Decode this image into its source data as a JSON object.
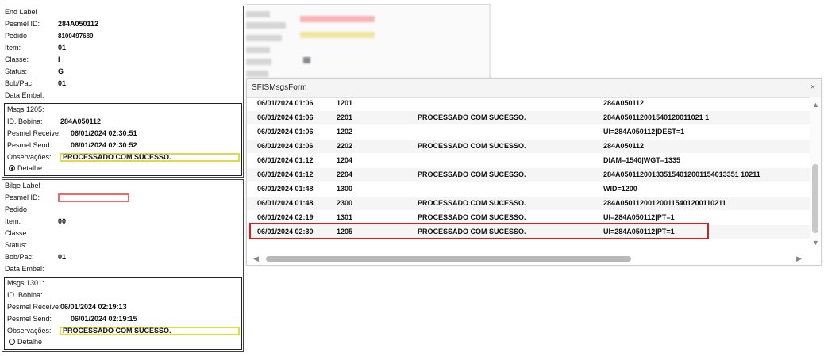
{
  "end_label": {
    "title": "End Label",
    "fields": [
      {
        "label": "Pesmel ID:",
        "value": "284A050112"
      },
      {
        "label": "Pedido",
        "value": "8100497689"
      },
      {
        "label": "Item:",
        "value": "01"
      },
      {
        "label": "Classe:",
        "value": "I"
      },
      {
        "label": "Status:",
        "value": "G"
      },
      {
        "label": "Bob/Pac:",
        "value": "01"
      },
      {
        "label": "Data Embal:",
        "value": ""
      }
    ],
    "msgs": {
      "title": "Msgs 1205:",
      "bobina_label": "ID. Bobina:",
      "bobina_value": "284A050112",
      "receive_label": "Pesmel Receive:",
      "receive_value": "06/01/2024 02:30:51",
      "send_label": "Pesmel Send:",
      "send_value": "06/01/2024 02:30:52",
      "obs_label": "Observações:",
      "obs_value": "PROCESSADO COM SUCESSO.",
      "detalhe_label": "Detalhe",
      "detalhe_checked": true
    }
  },
  "bilge_label": {
    "title": "Bilge Label",
    "fields": [
      {
        "label": "Pesmel ID:",
        "value": ""
      },
      {
        "label": "Pedido",
        "value": ""
      },
      {
        "label": "Item:",
        "value": "00"
      },
      {
        "label": "Classe:",
        "value": ""
      },
      {
        "label": "Status:",
        "value": ""
      },
      {
        "label": "Bob/Pac:",
        "value": "01"
      },
      {
        "label": "Data Embal:",
        "value": ""
      }
    ],
    "msgs": {
      "title": "Msgs 1301:",
      "bobina_label": "ID. Bobina:",
      "bobina_value": "",
      "receive_label": "Pesmel Receive:",
      "receive_value": "06/01/2024 02:19:13",
      "send_label": "Pesmel Send:",
      "send_value": "06/01/2024 02:19:15",
      "obs_label": "Observações:",
      "obs_value": "PROCESSADO COM SUCESSO.",
      "detalhe_label": "Detalhe",
      "detalhe_checked": false
    }
  },
  "sfis_window": {
    "title": "SFISMsgsForm",
    "close_icon": "×",
    "rows": [
      {
        "date": "06/01/2024 01:06",
        "code": "1201",
        "msg": "",
        "data": "284A050112"
      },
      {
        "date": "06/01/2024 01:06",
        "code": "2201",
        "msg": "PROCESSADO COM SUCESSO.",
        "data": "284A050112001540120011021 1"
      },
      {
        "date": "06/01/2024 01:06",
        "code": "1202",
        "msg": "",
        "data": "UI=284A050112|DEST=1"
      },
      {
        "date": "06/01/2024 01:06",
        "code": "2202",
        "msg": "PROCESSADO COM SUCESSO.",
        "data": "284A050112"
      },
      {
        "date": "06/01/2024 01:12",
        "code": "1204",
        "msg": "",
        "data": "DIAM=1540|WGT=1335"
      },
      {
        "date": "06/01/2024 01:12",
        "code": "2204",
        "msg": "PROCESSADO COM SUCESSO.",
        "data": "284A050112001335154012001154013351 10211"
      },
      {
        "date": "06/01/2024 01:48",
        "code": "1300",
        "msg": "",
        "data": "WID=1200"
      },
      {
        "date": "06/01/2024 01:48",
        "code": "2300",
        "msg": "PROCESSADO COM SUCESSO.",
        "data": "284A050112001200115401200110211"
      },
      {
        "date": "06/01/2024 02:19",
        "code": "1301",
        "msg": "PROCESSADO COM SUCESSO.",
        "data": "UI=284A050112|PT=1"
      },
      {
        "date": "06/01/2024 02:30",
        "code": "1205",
        "msg": "PROCESSADO COM SUCESSO.",
        "data": "UI=284A050112|PT=1"
      }
    ]
  }
}
